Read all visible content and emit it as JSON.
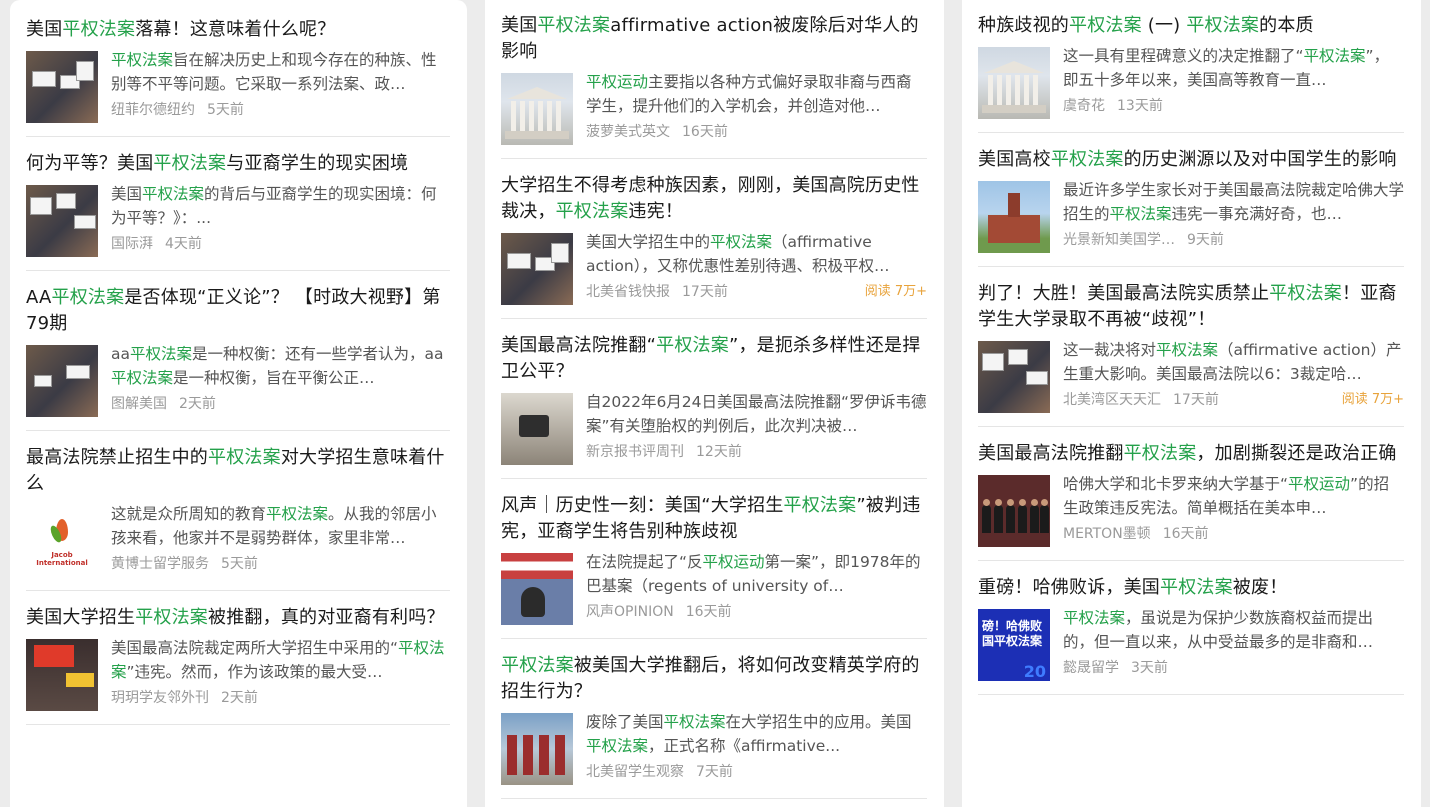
{
  "columns": [
    {
      "items": [
        {
          "title": [
            {
              "t": "美国"
            },
            {
              "t": "平权法案",
              "hl": true
            },
            {
              "t": "落幕！这意味着什么呢？"
            }
          ],
          "snippet": [
            {
              "t": "平权法案",
              "hl": true
            },
            {
              "t": "旨在解决历史上和现今存在的种族、性别等不平等问题。它采取一系列法案、政…"
            }
          ],
          "source": "纽菲尔德纽约",
          "time": "5天前",
          "reads": "",
          "thumb": "crowd"
        },
        {
          "title": [
            {
              "t": "何为平等？美国"
            },
            {
              "t": "平权法案",
              "hl": true
            },
            {
              "t": "与亚裔学生的现实困境"
            }
          ],
          "snippet": [
            {
              "t": "美国"
            },
            {
              "t": "平权法案",
              "hl": true
            },
            {
              "t": "的背后与亚裔学生的现实困境：何为平等？》：..."
            }
          ],
          "source": "国际湃",
          "time": "4天前",
          "reads": "",
          "thumb": "crowd2"
        },
        {
          "title": [
            {
              "t": "AA"
            },
            {
              "t": "平权法案",
              "hl": true
            },
            {
              "t": "是否体现“正义论”？ 【时政大视野】第79期"
            }
          ],
          "snippet": [
            {
              "t": "aa"
            },
            {
              "t": "平权法案",
              "hl": true
            },
            {
              "t": "是一种权衡：还有一些学者认为，aa"
            },
            {
              "t": "平权法案",
              "hl": true
            },
            {
              "t": "是一种权衡，旨在平衡公正…"
            }
          ],
          "source": "图解美国",
          "time": "2天前",
          "reads": "",
          "thumb": "crowd3"
        },
        {
          "title": [
            {
              "t": "最高法院禁止招生中的"
            },
            {
              "t": "平权法案",
              "hl": true
            },
            {
              "t": "对大学招生意味着什么"
            }
          ],
          "snippet": [
            {
              "t": "这就是众所周知的教育"
            },
            {
              "t": "平权法案",
              "hl": true
            },
            {
              "t": "。从我的邻居小孩来看，他家并不是弱势群体，家里非常…"
            }
          ],
          "source": "黄博士留学服务",
          "time": "5天前",
          "reads": "",
          "thumb": "logo",
          "logo_text": "Jacob International"
        },
        {
          "title": [
            {
              "t": "美国大学招生"
            },
            {
              "t": "平权法案",
              "hl": true
            },
            {
              "t": "被推翻，真的对亚裔有利吗？"
            }
          ],
          "snippet": [
            {
              "t": "美国最高法院裁定两所大学招生中采用的“"
            },
            {
              "t": "平权法案",
              "hl": true
            },
            {
              "t": "”违宪。然而，作为该政策的最大受…"
            }
          ],
          "source": "玥玥学友邻外刊",
          "time": "2天前",
          "reads": "",
          "thumb": "red"
        }
      ]
    },
    {
      "items": [
        {
          "title": [
            {
              "t": "美国"
            },
            {
              "t": "平权法案",
              "hl": true
            },
            {
              "t": "affirmative action被废除后对华人的影响"
            }
          ],
          "snippet": [
            {
              "t": "平权运动",
              "hl": true
            },
            {
              "t": "主要指以各种方式偏好录取非裔与西裔学生，提升他们的入学机会，并创造对他…"
            }
          ],
          "source": "菠萝美式英文",
          "time": "16天前",
          "reads": "",
          "thumb": "court"
        },
        {
          "title": [
            {
              "t": "大学招生不得考虑种族因素，刚刚，美国高院历史性裁决，"
            },
            {
              "t": "平权法案",
              "hl": true
            },
            {
              "t": "违宪！"
            }
          ],
          "snippet": [
            {
              "t": "美国大学招生中的"
            },
            {
              "t": "平权法案",
              "hl": true
            },
            {
              "t": "（affirmative action），又称优惠性差别待遇、积极平权…"
            }
          ],
          "source": "北美省钱快报",
          "time": "17天前",
          "reads": "阅读 7万+",
          "thumb": "crowd"
        },
        {
          "title": [
            {
              "t": "美国最高法院推翻“"
            },
            {
              "t": "平权法案",
              "hl": true
            },
            {
              "t": "”，是扼杀多样性还是捍卫公平？"
            }
          ],
          "snippet": [
            {
              "t": "自2022年6月24日美国最高法院推翻“罗伊诉韦德案”有关堕胎权的判例后，此次判决被…"
            }
          ],
          "source": "新京报书评周刊",
          "time": "12天前",
          "reads": "",
          "thumb": "camera"
        },
        {
          "title": [
            {
              "t": "风声｜历史性一刻：美国“大学招生"
            },
            {
              "t": "平权法案",
              "hl": true
            },
            {
              "t": "”被判违宪，亚裔学生将告别种族歧视"
            }
          ],
          "snippet": [
            {
              "t": "在法院提起了“反"
            },
            {
              "t": "平权运动",
              "hl": true
            },
            {
              "t": "第一案”，即1978年的巴基案（regents of university of…"
            }
          ],
          "source": "风声OPINION",
          "time": "16天前",
          "reads": "",
          "thumb": "flag"
        },
        {
          "title": [
            {
              "t": "平权法案",
              "hl": true
            },
            {
              "t": "被美国大学推翻后，将如何改变精英学府的招生行为？"
            }
          ],
          "snippet": [
            {
              "t": "废除了美国"
            },
            {
              "t": "平权法案",
              "hl": true
            },
            {
              "t": "在大学招生中的应用。美国"
            },
            {
              "t": "平权法案",
              "hl": true
            },
            {
              "t": "，正式名称《affirmative..."
            }
          ],
          "source": "北美留学生观察",
          "time": "7天前",
          "reads": "",
          "thumb": "campus"
        }
      ]
    },
    {
      "items": [
        {
          "title": [
            {
              "t": "种族歧视的"
            },
            {
              "t": "平权法案",
              "hl": true
            },
            {
              "t": " (一) "
            },
            {
              "t": "平权法案",
              "hl": true
            },
            {
              "t": "的本质"
            }
          ],
          "snippet": [
            {
              "t": "这一具有里程碑意义的决定推翻了“"
            },
            {
              "t": "平权法案",
              "hl": true
            },
            {
              "t": "”，即五十多年以来，美国高等教育一直…"
            }
          ],
          "source": "虞奇花",
          "time": "13天前",
          "reads": "",
          "thumb": "court"
        },
        {
          "title": [
            {
              "t": "美国高校"
            },
            {
              "t": "平权法案",
              "hl": true
            },
            {
              "t": "的历史渊源以及对中国学生的影响"
            }
          ],
          "snippet": [
            {
              "t": "最近许多学生家长对于美国最高法院裁定哈佛大学招生的"
            },
            {
              "t": "平权法案",
              "hl": true
            },
            {
              "t": "违宪一事充满好奇，也…"
            }
          ],
          "source": "光景新知美国学…",
          "time": "9天前",
          "reads": "",
          "thumb": "hall"
        },
        {
          "title": [
            {
              "t": "判了！大胜！美国最高法院实质禁止"
            },
            {
              "t": "平权法案",
              "hl": true
            },
            {
              "t": "！亚裔学生大学录取不再被“歧视”！"
            }
          ],
          "snippet": [
            {
              "t": "这一裁决将对"
            },
            {
              "t": "平权法案",
              "hl": true
            },
            {
              "t": "（affirmative action）产生重大影响。美国最高法院以6：3裁定哈…"
            }
          ],
          "source": "北美湾区天天汇",
          "time": "17天前",
          "reads": "阅读 7万+",
          "thumb": "crowd2"
        },
        {
          "title": [
            {
              "t": "美国最高法院推翻"
            },
            {
              "t": "平权法案",
              "hl": true
            },
            {
              "t": "，加剧撕裂还是政治正确"
            }
          ],
          "snippet": [
            {
              "t": "哈佛大学和北卡罗来纳大学基于“"
            },
            {
              "t": "平权运动",
              "hl": true
            },
            {
              "t": "”的招生政策违反宪法。简单概括在美本申…"
            }
          ],
          "source": "MERTON墨顿",
          "time": "16天前",
          "reads": "",
          "thumb": "justice"
        },
        {
          "title": [
            {
              "t": "重磅！哈佛败诉，美国"
            },
            {
              "t": "平权法案",
              "hl": true
            },
            {
              "t": "被废！"
            }
          ],
          "snippet": [
            {
              "t": "平权法案",
              "hl": true
            },
            {
              "t": "，虽说是为保护少数族裔权益而提出的，但一直以来，从中受益最多的是非裔和…"
            }
          ],
          "source": "懿晟留学",
          "time": "3天前",
          "reads": "",
          "thumb": "blue",
          "thumb_text": "磅！哈佛败\n国平权法案",
          "thumb_num": "20"
        }
      ]
    }
  ],
  "colors": {
    "highlight": "#24a14a",
    "reads": "#e8a33b",
    "meta": "#9a9a9a"
  }
}
